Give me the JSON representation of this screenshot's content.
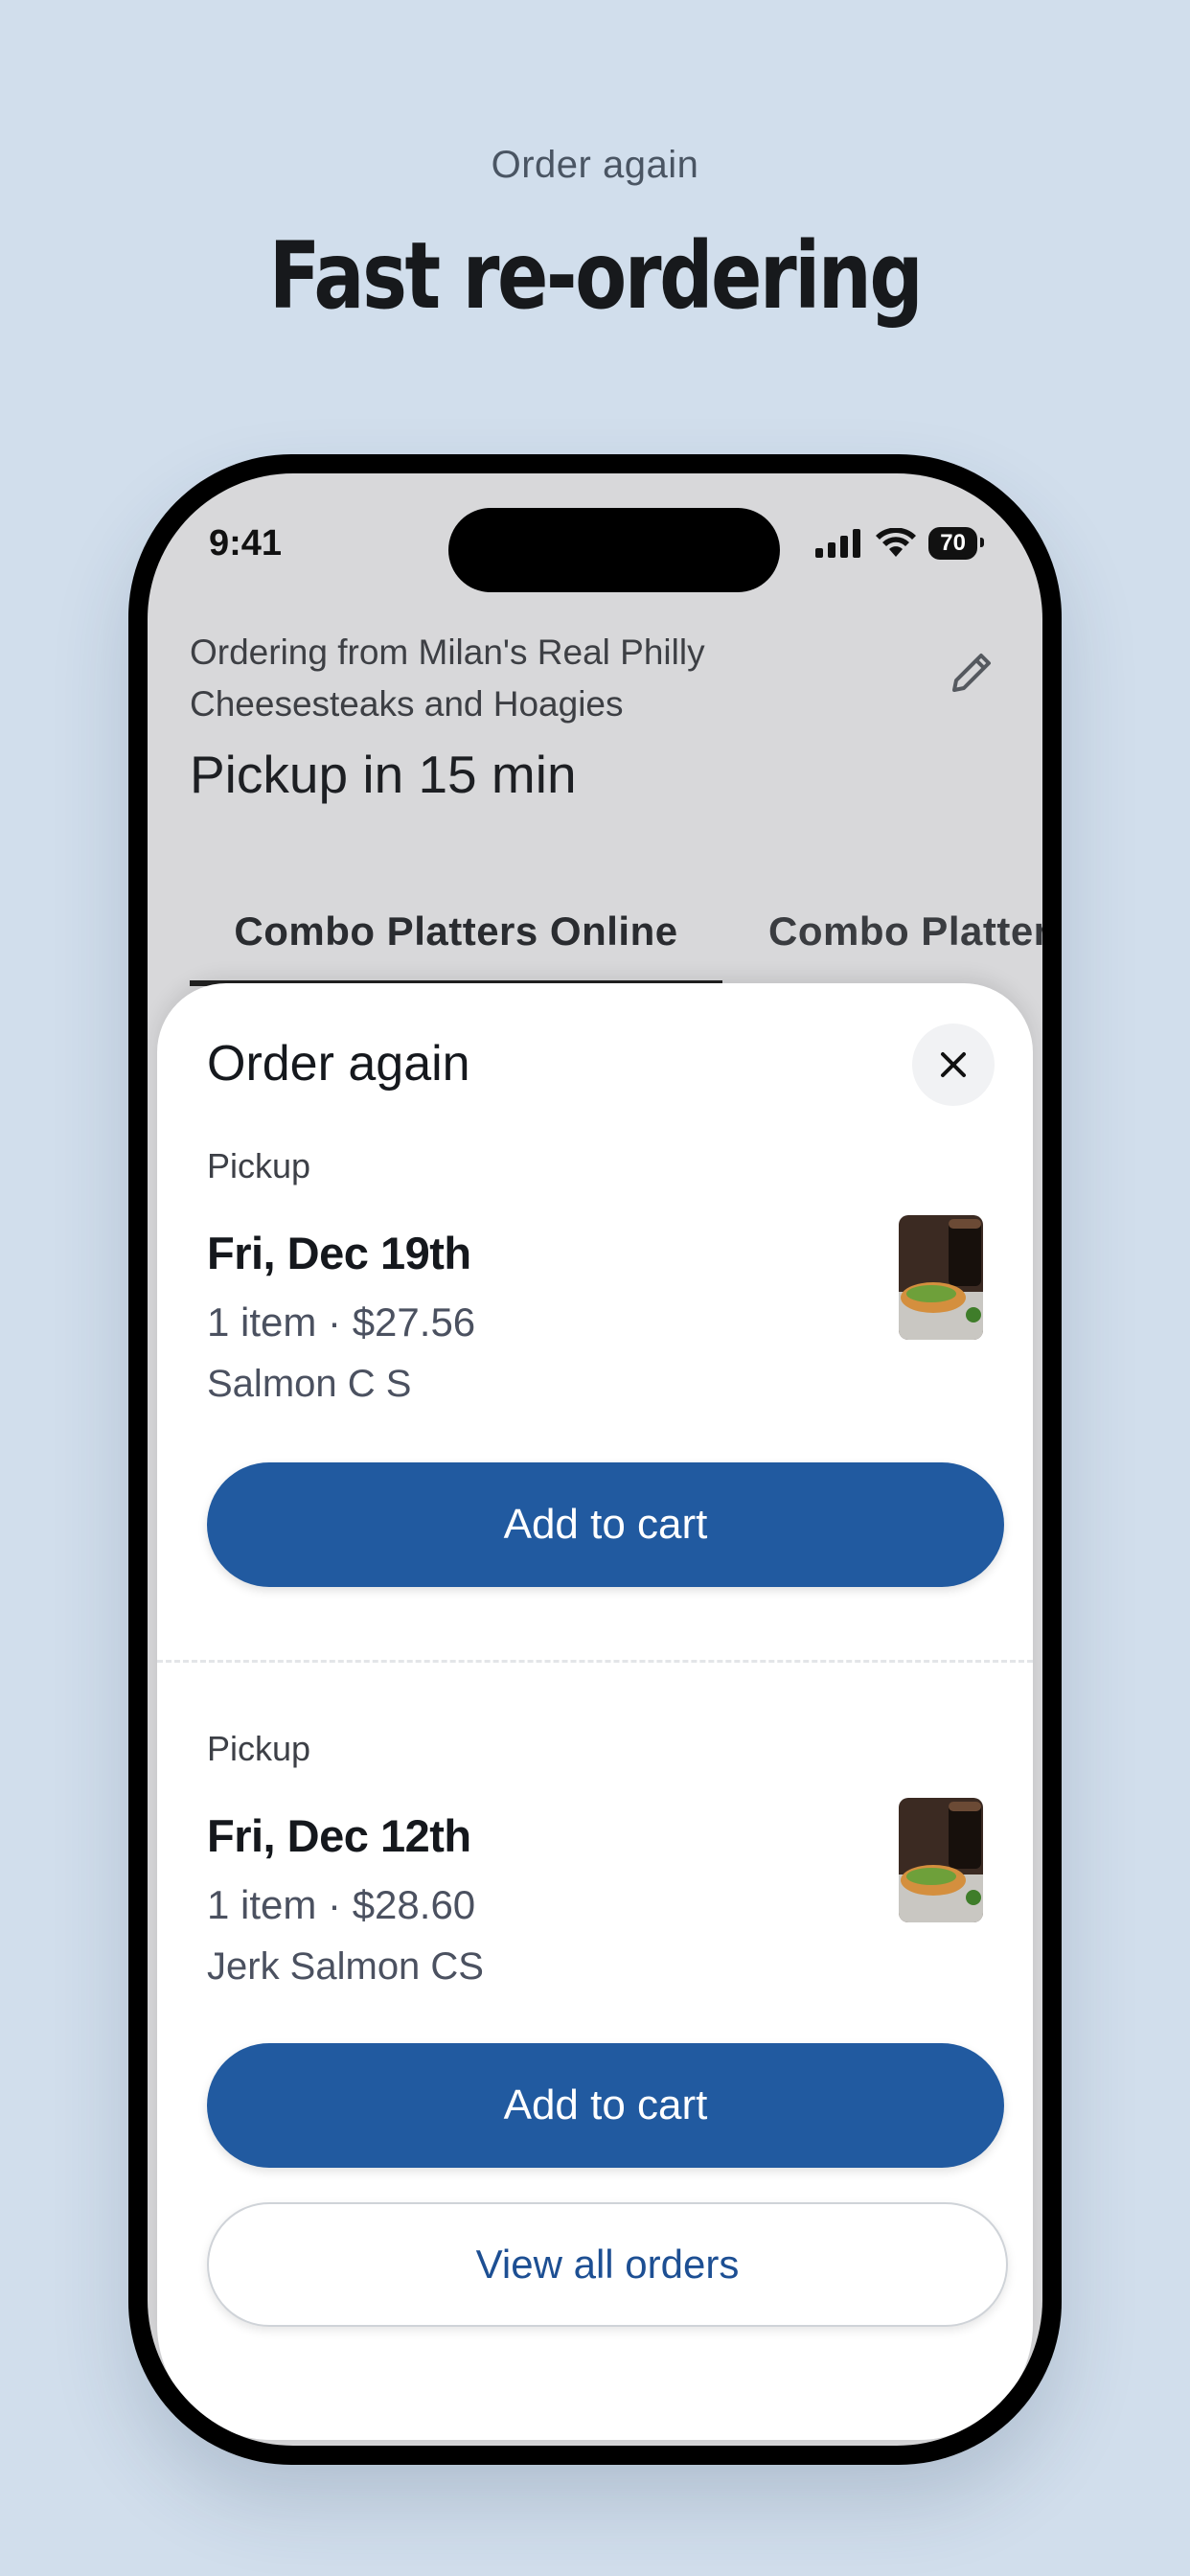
{
  "promo": {
    "kicker": "Order again",
    "title": "Fast re-ordering"
  },
  "status_bar": {
    "time": "9:41",
    "battery": "70"
  },
  "header": {
    "ordering_from": "Ordering from Milan's Real Philly Cheesesteaks and Hoagies",
    "pickup_time": "Pickup in 15 min"
  },
  "tabs": [
    {
      "label": "Combo Platters Online",
      "active": true
    },
    {
      "label": "Combo Platters"
    }
  ],
  "sheet": {
    "title": "Order again",
    "orders": [
      {
        "mode": "Pickup",
        "date": "Fri, Dec 19th",
        "summary": "1 item · $27.56",
        "items": "Salmon C S",
        "button": "Add to cart"
      },
      {
        "mode": "Pickup",
        "date": "Fri, Dec 12th",
        "summary": "1 item · $28.60",
        "items": "Jerk Salmon CS",
        "button": "Add to cart"
      }
    ],
    "view_all": "View all orders"
  },
  "colors": {
    "background": "#d1deec",
    "accent": "#215aa0",
    "link": "#1d4f93"
  },
  "icons": [
    "signal-icon",
    "wifi-icon",
    "battery-icon",
    "pencil-icon",
    "close-icon"
  ]
}
